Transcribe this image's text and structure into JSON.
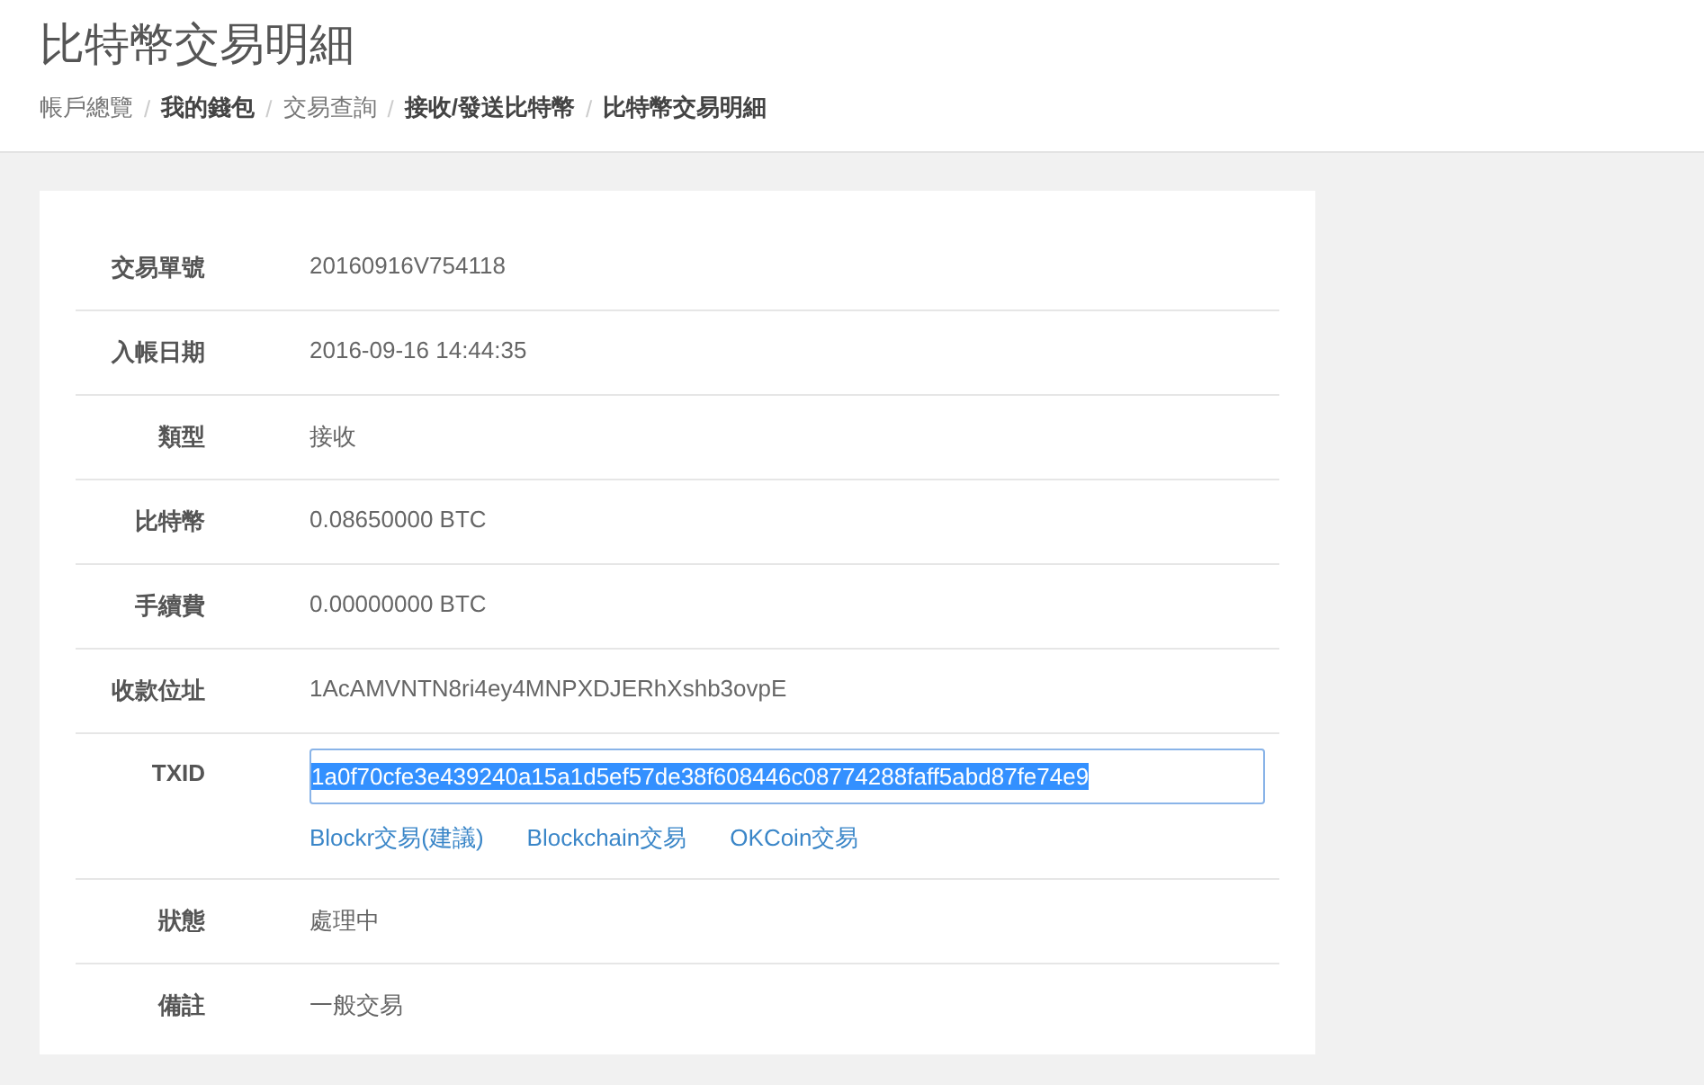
{
  "page_title": "比特幣交易明細",
  "breadcrumb_separator": "/",
  "breadcrumb": [
    {
      "label": "帳戶總覽",
      "bold": false
    },
    {
      "label": "我的錢包",
      "bold": true
    },
    {
      "label": "交易查詢",
      "bold": false
    },
    {
      "label": "接收/發送比特幣",
      "bold": true
    },
    {
      "label": "比特幣交易明細",
      "bold": true
    }
  ],
  "details": [
    {
      "kind": "text",
      "label": "交易單號",
      "value": "20160916V754118"
    },
    {
      "kind": "text",
      "label": "入帳日期",
      "value": "2016-09-16 14:44:35"
    },
    {
      "kind": "text",
      "label": "類型",
      "value": "接收"
    },
    {
      "kind": "text",
      "label": "比特幣",
      "value": "0.08650000 BTC"
    },
    {
      "kind": "text",
      "label": "手續費",
      "value": "0.00000000 BTC"
    },
    {
      "kind": "text",
      "label": "收款位址",
      "value": "1AcAMVNTN8ri4ey4MNPXDJERhXshb3ovpE"
    },
    {
      "kind": "txid",
      "label": "TXID",
      "value": "1a0f70cfe3e439240a15a1d5ef57de38f608446c08774288faff5abd87fe74e9",
      "selected": true,
      "links": [
        "Blockr交易(建議)",
        "Blockchain交易",
        "OKCoin交易"
      ]
    },
    {
      "kind": "text",
      "label": "狀態",
      "value": "處理中"
    },
    {
      "kind": "text",
      "label": "備註",
      "value": "一般交易"
    }
  ]
}
